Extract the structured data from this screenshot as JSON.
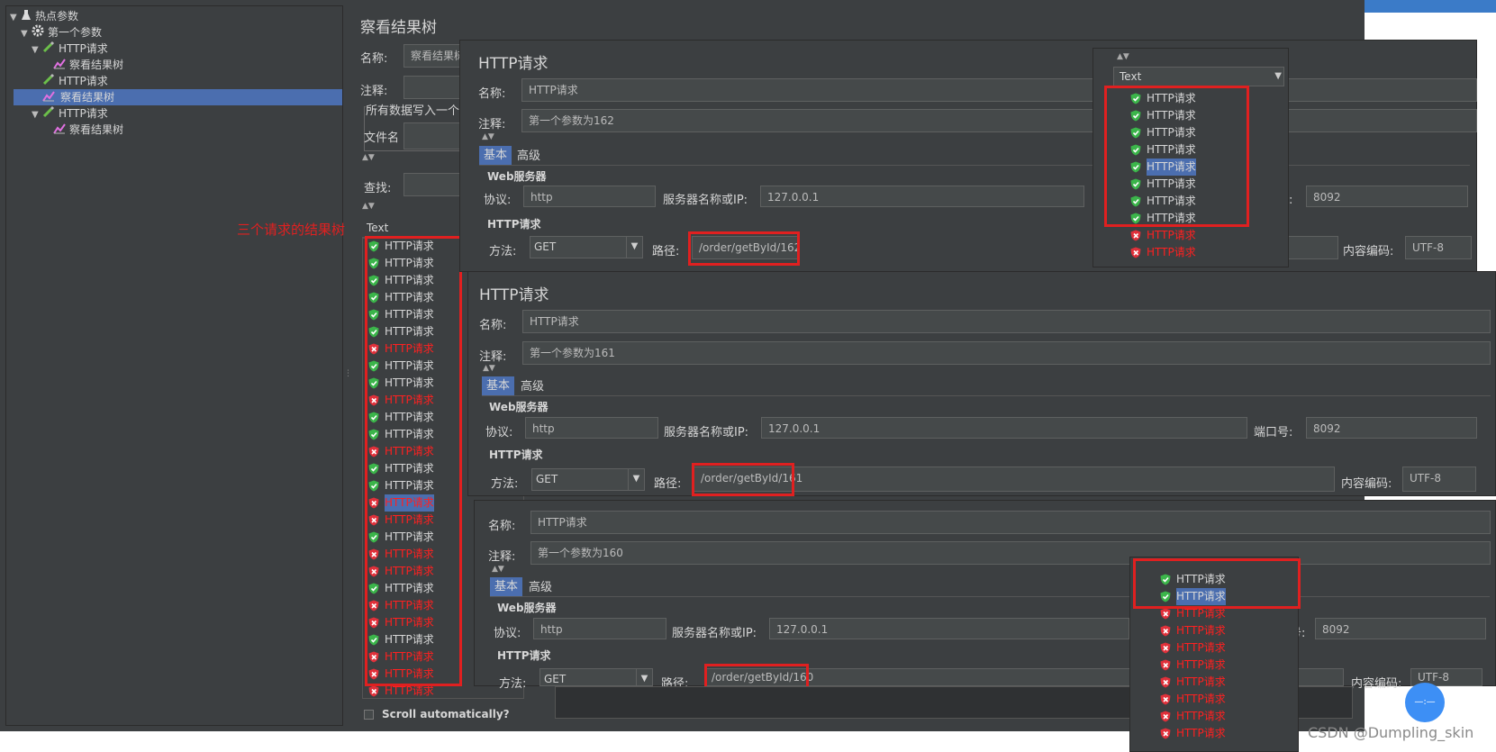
{
  "tree": {
    "items": [
      {
        "label": "热点参数",
        "icon": "flask-icon",
        "level": 0,
        "toggle": "▼"
      },
      {
        "label": "第一个参数",
        "icon": "gear-icon",
        "level": 1,
        "toggle": "▼"
      },
      {
        "label": "HTTP请求",
        "icon": "pipette-icon",
        "level": 2,
        "toggle": "▼"
      },
      {
        "label": "察看结果树",
        "icon": "chart-icon",
        "level": 3,
        "toggle": ""
      },
      {
        "label": "HTTP请求",
        "icon": "pipette-icon",
        "level": 2,
        "toggle": ""
      },
      {
        "label": "察看结果树",
        "icon": "chart-icon",
        "level": 2,
        "toggle": "",
        "selected": true
      },
      {
        "label": "HTTP请求",
        "icon": "pipette-icon",
        "level": 2,
        "toggle": "▼"
      },
      {
        "label": "察看结果树",
        "icon": "chart-icon",
        "level": 3,
        "toggle": ""
      }
    ]
  },
  "results_tree": {
    "title": "察看结果树",
    "name_label": "名称:",
    "name_value": "察看结果树",
    "comment_label": "注释:",
    "write_all_label": "所有数据写入一个",
    "filename_label": "文件名",
    "search_label": "查找:",
    "renderer": "Text",
    "annotation": "三个请求的结果树",
    "scroll_auto": "Scroll automatically?",
    "results": [
      {
        "label": "HTTP请求",
        "ok": true
      },
      {
        "label": "HTTP请求",
        "ok": true
      },
      {
        "label": "HTTP请求",
        "ok": true
      },
      {
        "label": "HTTP请求",
        "ok": true
      },
      {
        "label": "HTTP请求",
        "ok": true
      },
      {
        "label": "HTTP请求",
        "ok": true
      },
      {
        "label": "HTTP请求",
        "ok": false
      },
      {
        "label": "HTTP请求",
        "ok": true
      },
      {
        "label": "HTTP请求",
        "ok": true
      },
      {
        "label": "HTTP请求",
        "ok": false
      },
      {
        "label": "HTTP请求",
        "ok": true
      },
      {
        "label": "HTTP请求",
        "ok": true
      },
      {
        "label": "HTTP请求",
        "ok": false
      },
      {
        "label": "HTTP请求",
        "ok": true
      },
      {
        "label": "HTTP请求",
        "ok": true
      },
      {
        "label": "HTTP请求",
        "ok": false,
        "selected": true
      },
      {
        "label": "HTTP请求",
        "ok": false
      },
      {
        "label": "HTTP请求",
        "ok": true
      },
      {
        "label": "HTTP请求",
        "ok": false
      },
      {
        "label": "HTTP请求",
        "ok": false
      },
      {
        "label": "HTTP请求",
        "ok": true
      },
      {
        "label": "HTTP请求",
        "ok": false
      },
      {
        "label": "HTTP请求",
        "ok": false
      },
      {
        "label": "HTTP请求",
        "ok": true
      },
      {
        "label": "HTTP请求",
        "ok": false
      },
      {
        "label": "HTTP请求",
        "ok": false
      },
      {
        "label": "HTTP请求",
        "ok": false
      }
    ]
  },
  "req162": {
    "title": "HTTP请求",
    "name_label": "名称:",
    "name_value": "HTTP请求",
    "comment_label": "注释:",
    "comment_value": "第一个参数为162",
    "tab_basic": "基本",
    "tab_advanced": "高级",
    "web_server": "Web服务器",
    "protocol_label": "协议:",
    "protocol_value": "http",
    "server_label": "服务器名称或IP:",
    "server_value": "127.0.0.1",
    "port_label": "号:",
    "port_value": "8092",
    "http_request": "HTTP请求",
    "method_label": "方法:",
    "method_value": "GET",
    "path_label": "路径:",
    "path_value": "/order/getById/162",
    "encoding_label": "内容编码:",
    "encoding_value": "UTF-8"
  },
  "popup162": {
    "renderer": "Text",
    "results": [
      {
        "label": "HTTP请求",
        "ok": true
      },
      {
        "label": "HTTP请求",
        "ok": true
      },
      {
        "label": "HTTP请求",
        "ok": true
      },
      {
        "label": "HTTP请求",
        "ok": true
      },
      {
        "label": "HTTP请求",
        "ok": true,
        "selected": true
      },
      {
        "label": "HTTP请求",
        "ok": true
      },
      {
        "label": "HTTP请求",
        "ok": true
      },
      {
        "label": "HTTP请求",
        "ok": true
      },
      {
        "label": "HTTP请求",
        "ok": false
      },
      {
        "label": "HTTP请求",
        "ok": false
      }
    ]
  },
  "req161": {
    "title": "HTTP请求",
    "name_label": "名称:",
    "name_value": "HTTP请求",
    "comment_label": "注释:",
    "comment_value": "第一个参数为161",
    "tab_basic": "基本",
    "tab_advanced": "高级",
    "web_server": "Web服务器",
    "protocol_label": "协议:",
    "protocol_value": "http",
    "server_label": "服务器名称或IP:",
    "server_value": "127.0.0.1",
    "port_label": "端口号:",
    "port_value": "8092",
    "http_request": "HTTP请求",
    "method_label": "方法:",
    "method_value": "GET",
    "path_label": "路径:",
    "path_value": "/order/getById/161",
    "encoding_label": "内容编码:",
    "encoding_value": "UTF-8"
  },
  "req160": {
    "name_label": "名称:",
    "name_value": "HTTP请求",
    "comment_label": "注释:",
    "comment_value": "第一个参数为160",
    "tab_basic": "基本",
    "tab_advanced": "高级",
    "web_server": "Web服务器",
    "protocol_label": "协议:",
    "protocol_value": "http",
    "server_label": "服务器名称或IP:",
    "server_value": "127.0.0.1",
    "port_label": "号:",
    "port_value": "8092",
    "http_request": "HTTP请求",
    "method_label": "方法:",
    "method_value": "GET",
    "path_label": "路径:",
    "path_value": "/order/getById/160",
    "encoding_label": "内容编码:",
    "encoding_value": "UTF-8"
  },
  "popup160": {
    "results": [
      {
        "label": "HTTP请求",
        "ok": true
      },
      {
        "label": "HTTP请求",
        "ok": true,
        "selected": true
      },
      {
        "label": "HTTP请求",
        "ok": false
      },
      {
        "label": "HTTP请求",
        "ok": false
      },
      {
        "label": "HTTP请求",
        "ok": false
      },
      {
        "label": "HTTP请求",
        "ok": false
      },
      {
        "label": "HTTP请求",
        "ok": false
      },
      {
        "label": "HTTP请求",
        "ok": false
      },
      {
        "label": "HTTP请求",
        "ok": false
      },
      {
        "label": "HTTP请求",
        "ok": false
      }
    ]
  },
  "watermark": "CSDN @Dumpling_skin",
  "colors": {
    "panel": "#3c3f41",
    "field": "#45494a",
    "selection": "#4b6eaf",
    "error": "#ff2020",
    "annotation": "#e02020"
  }
}
